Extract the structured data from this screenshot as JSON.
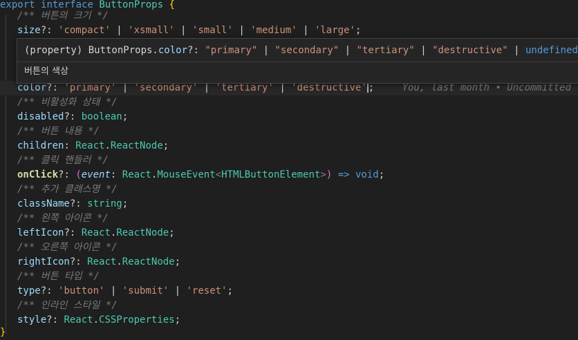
{
  "code": {
    "l1": {
      "export_kw": "export",
      "interface_kw": "interface",
      "name": "ButtonProps",
      "brace_open": "{"
    },
    "l2": {
      "comment": "/** 버튼의 크기 */"
    },
    "l3": {
      "prop": "size",
      "q": "?: ",
      "v1": "'compact'",
      "v2": "'xsmall'",
      "v3": "'small'",
      "v4": "'medium'",
      "v5": "'large'",
      "sep": " | ",
      "semi": ";"
    },
    "l4": {
      "prop": "color",
      "q": "?: ",
      "v1": "'primary'",
      "v2": "'secondary'",
      "v3": "'tertiary'",
      "v4": "'destructive'",
      "sep": " | ",
      "semi": ";"
    },
    "l5": {
      "comment": "/** 비활성화 상태 */"
    },
    "l6": {
      "prop": "disabled",
      "q": "?: ",
      "type": "boolean",
      "semi": ";"
    },
    "l7": {
      "comment": "/** 버튼 내용 */"
    },
    "l8": {
      "prop": "children",
      "q": ": ",
      "ns": "React",
      "dot": ".",
      "type": "ReactNode",
      "semi": ";"
    },
    "l9": {
      "comment": "/** 클릭 핸들러 */"
    },
    "l10": {
      "prop": "onClick",
      "q": "?: ",
      "po": "(",
      "param": "event",
      "colon": ": ",
      "ns": "React",
      "dot": ".",
      "type": "MouseEvent",
      "lt": "<",
      "generic": "HTMLButtonElement",
      "gt": ">",
      "pc": ")",
      "arrow": " => ",
      "ret": "void",
      "semi": ";"
    },
    "l11": {
      "comment": "/** 추가 클래스명 */"
    },
    "l12": {
      "prop": "className",
      "q": "?: ",
      "type": "string",
      "semi": ";"
    },
    "l13": {
      "comment": "/** 왼쪽 아이콘 */"
    },
    "l14": {
      "prop": "leftIcon",
      "q": "?: ",
      "ns": "React",
      "dot": ".",
      "type": "ReactNode",
      "semi": ";"
    },
    "l15": {
      "comment": "/** 오른쪽 아이콘 */"
    },
    "l16": {
      "prop": "rightIcon",
      "q": "?: ",
      "ns": "React",
      "dot": ".",
      "type": "ReactNode",
      "semi": ";"
    },
    "l17": {
      "comment": "/** 버튼 타입 */"
    },
    "l18": {
      "prop": "type",
      "q": "?: ",
      "v1": "'button'",
      "v2": "'submit'",
      "v3": "'reset'",
      "sep": " | ",
      "semi": ";"
    },
    "l19": {
      "comment": "/** 인라인 스타일 */"
    },
    "l20": {
      "prop": "style",
      "q": "?: ",
      "ns": "React",
      "dot": ".",
      "type": "CSSProperties",
      "semi": ";"
    },
    "l21": {
      "brace_close": "}"
    }
  },
  "blame": "You, last month • Uncommitted",
  "hover": {
    "sig_prefix": "(property) ButtonProps.",
    "sig_prop": "color",
    "sig_q": "?: ",
    "v1": "\"primary\"",
    "v2": "\"secondary\"",
    "v3": "\"tertiary\"",
    "v4": "\"destructive\"",
    "sep": " | ",
    "undef": "undefined",
    "doc": "버튼의 색상"
  }
}
